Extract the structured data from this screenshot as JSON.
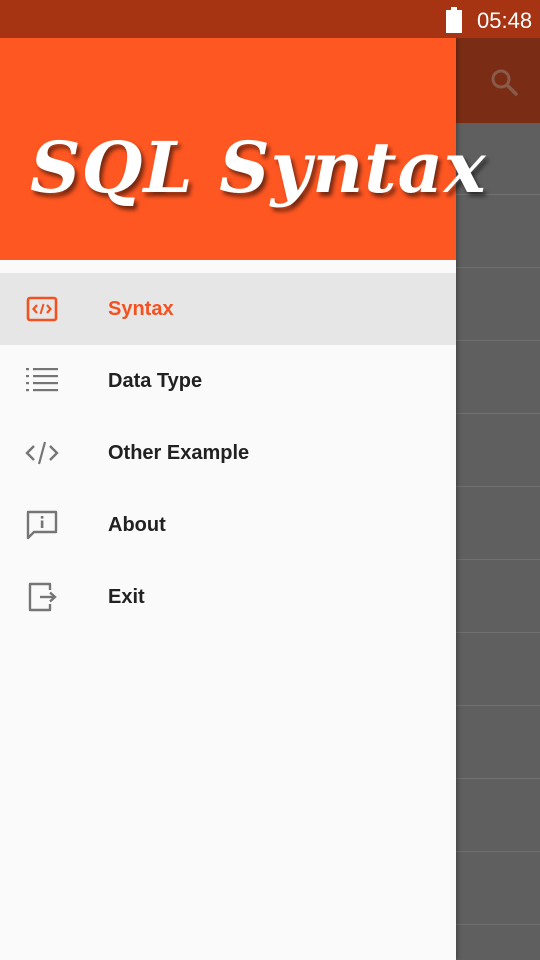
{
  "status_bar": {
    "time": "05:48"
  },
  "app": {
    "search_icon": "search-icon"
  },
  "drawer": {
    "header_title": "SQL Syntax",
    "accent_color": "#ff5722",
    "items": [
      {
        "label": "Syntax",
        "icon": "code-box-icon",
        "active": true
      },
      {
        "label": "Data Type",
        "icon": "list-icon",
        "active": false
      },
      {
        "label": "Other Example",
        "icon": "code-icon",
        "active": false
      },
      {
        "label": "About",
        "icon": "info-message-icon",
        "active": false
      },
      {
        "label": "Exit",
        "icon": "exit-icon",
        "active": false
      }
    ]
  }
}
